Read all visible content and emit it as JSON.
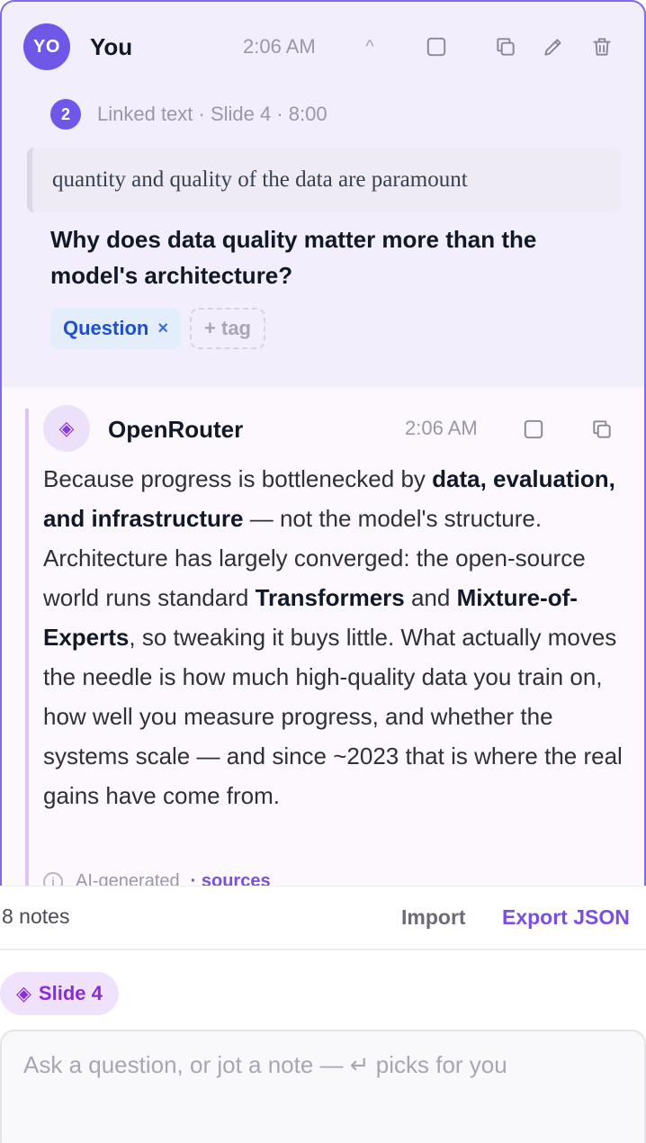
{
  "note": {
    "avatar_initials": "YO",
    "author": "You",
    "time": "2:06 AM",
    "collapse_glyph": "^",
    "linked_count": "2",
    "linked_label": "Linked text · Slide 4 · 8:00",
    "quote": "quantity and quality of the data are paramount",
    "question": "Why does data quality matter more than the model's architecture?",
    "tags": [
      {
        "label": "Question",
        "remove": "×"
      }
    ],
    "add_tag_label": "+ tag",
    "icons": [
      "checkbox-icon",
      "copy-icon",
      "edit-icon",
      "trash-icon"
    ]
  },
  "reply": {
    "logo_glyph": "◈",
    "name": "OpenRouter",
    "time": "2:06 AM",
    "segments": [
      {
        "text": "Because progress is bottlenecked by ",
        "bold": false
      },
      {
        "text": "data, evaluation, and infrastructure",
        "bold": true
      },
      {
        "text": " — not the model's structure. Architecture has largely converged: the open-source world runs standard ",
        "bold": false
      },
      {
        "text": "Transformers",
        "bold": true
      },
      {
        "text": " and ",
        "bold": false
      },
      {
        "text": "Mixture-of-Experts",
        "bold": true
      },
      {
        "text": ", so tweaking it buys little. What actually moves the needle is how much high-quality data you train on, how well you measure progress, and whether the systems scale — and since ~2023 that is where the real gains have come from.",
        "bold": false
      }
    ],
    "footer_label": "AI-generated",
    "footer_sources": "· sources",
    "icons": [
      "checkbox-icon",
      "copy-icon"
    ]
  },
  "toolbar": {
    "notes_count": "8 notes",
    "import_label": "Import",
    "export_label": "Export JSON"
  },
  "composer": {
    "slide_chip_glyph": "◈",
    "slide_chip_label": "Slide 4",
    "placeholder": "Ask a question, or jot a note — ↵ picks for you"
  },
  "colors": {
    "accent": "#6f57e8",
    "brand_purple": "#7a4fe0",
    "card_bg": "#f2eefb",
    "reply_bg": "#fcf8fe",
    "tag_blue": "#1e4fd0"
  }
}
